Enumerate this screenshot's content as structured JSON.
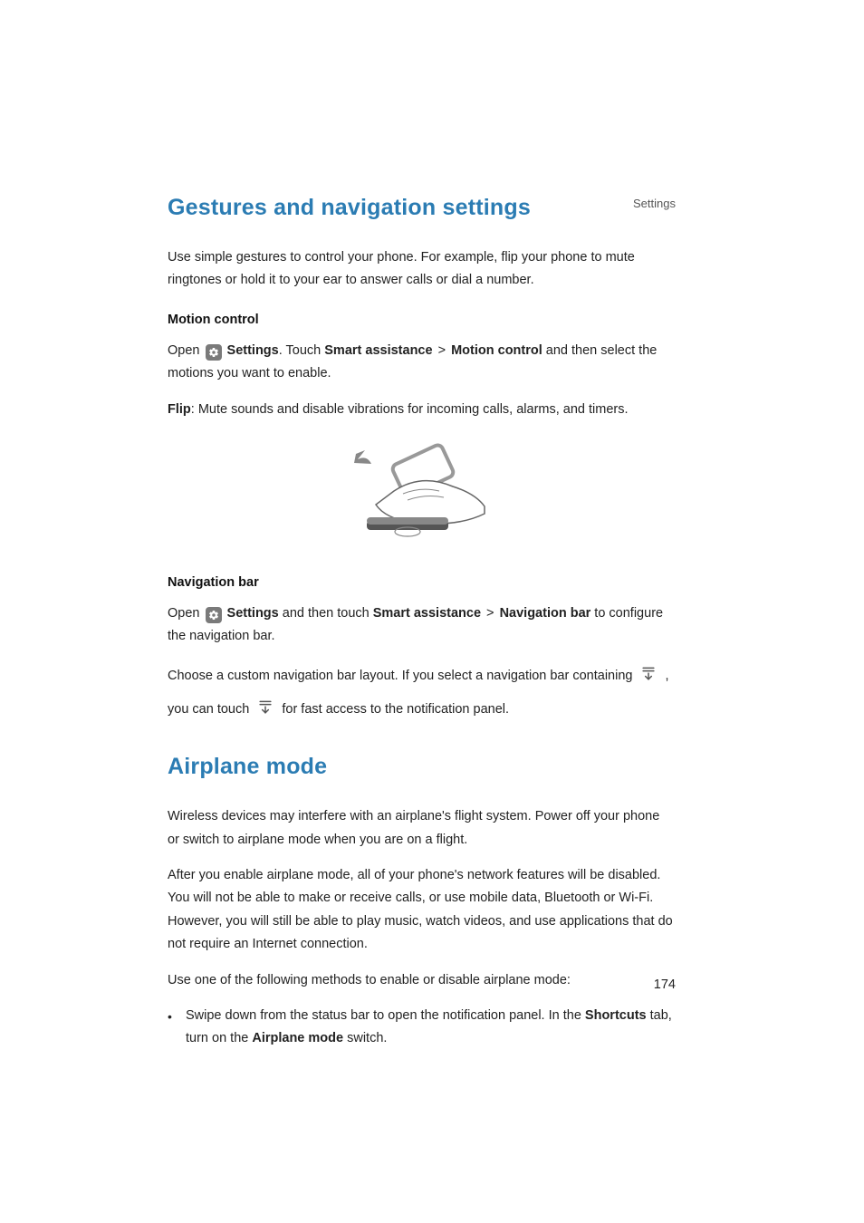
{
  "header": {
    "section": "Settings"
  },
  "h1a": "Gestures and navigation settings",
  "intro": "Use simple gestures to control your phone. For example, flip your phone to mute ringtones or hold it to your ear to answer calls or dial a number.",
  "motion": {
    "heading": "Motion control",
    "open": "Open ",
    "settings": "Settings",
    "touch": ". Touch ",
    "smart": "Smart assistance",
    "gt": " > ",
    "mc": "Motion control",
    "tail": " and then select the motions you want to enable.",
    "flip_b": "Flip",
    "flip_rest": ": Mute sounds and disable vibrations for incoming calls, alarms, and timers."
  },
  "nav": {
    "heading": "Navigation bar",
    "open": "Open ",
    "settings": "Settings",
    "then": " and then touch ",
    "smart": "Smart assistance",
    "gt": " > ",
    "nb": "Navigation bar",
    "tail": " to configure the navigation bar.",
    "choose_a": "Choose a custom navigation bar layout. If you select a navigation bar containing ",
    "choose_b": " , you can touch ",
    "choose_c": " for fast access to the notification panel."
  },
  "h1b": "Airplane mode",
  "air": {
    "p1": "Wireless devices may interfere with an airplane's flight system. Power off your phone or switch to airplane mode when you are on a flight.",
    "p2": "After you enable airplane mode, all of your phone's network features will be disabled. You will not be able to make or receive calls, or use mobile data, Bluetooth or Wi-Fi. However, you will still be able to play music, watch videos, and use applications that do not require an Internet connection.",
    "p3": "Use one of the following methods to enable or disable airplane mode:",
    "bullet_a": "Swipe down from the status bar to open the notification panel. In the ",
    "bullet_b": "Shortcuts",
    "bullet_c": " tab, turn on the ",
    "bullet_d": "Airplane mode",
    "bullet_e": " switch."
  },
  "page_number": "174"
}
